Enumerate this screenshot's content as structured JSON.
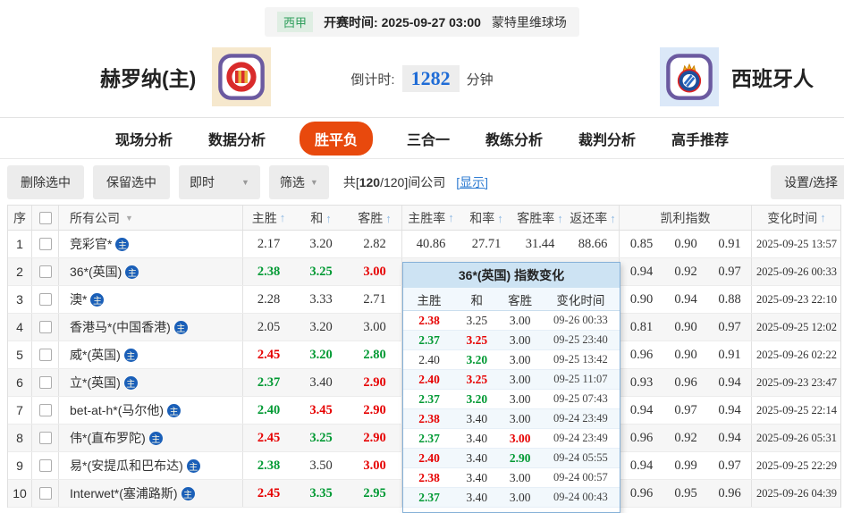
{
  "colors": {
    "up_green": "#009933",
    "down_red": "#e60000",
    "accent_red": "#e8490d",
    "countdown_blue": "#1f6cd6",
    "link_blue": "#2f7cd2"
  },
  "icons": {
    "sort_asc": "↑",
    "dropdown": "▼",
    "home_badge": "主"
  },
  "match_bar": {
    "league": "西甲",
    "kickoff_label": "开赛时间:",
    "kickoff_time": "2025-09-27 03:00",
    "venue": "蒙特里维球场"
  },
  "teams": {
    "home": "赫罗纳(主)",
    "away": "西班牙人",
    "countdown_label": "倒计时:",
    "countdown_value": "1282",
    "countdown_unit": "分钟"
  },
  "tabs": [
    {
      "id": "live-analysis",
      "label": "现场分析",
      "active": false
    },
    {
      "id": "data-analysis",
      "label": "数据分析",
      "active": false
    },
    {
      "id": "win-draw-loss",
      "label": "胜平负",
      "active": true
    },
    {
      "id": "three-in-one",
      "label": "三合一",
      "active": false
    },
    {
      "id": "coach-analysis",
      "label": "教练分析",
      "active": false
    },
    {
      "id": "referee-analysis",
      "label": "裁判分析",
      "active": false
    },
    {
      "id": "expert-picks",
      "label": "高手推荐",
      "active": false
    }
  ],
  "toolbar": {
    "delete_label": "删除选中",
    "keep_label": "保留选中",
    "instant_label": "即时",
    "filter_label": "筛选",
    "count_prefix": "共[",
    "count_bold": "120",
    "count_suffix": "/120]间公司",
    "show_link": "[显示]",
    "settings_label": "设置/选择"
  },
  "table": {
    "headers": {
      "seq": "序",
      "company": "所有公司",
      "home": "主胜",
      "draw": "和",
      "away": "客胜",
      "home_rate": "主胜率",
      "draw_rate": "和率",
      "away_rate": "客胜率",
      "return_rate": "返还率",
      "kelly": "凯利指数",
      "change_time": "变化时间"
    },
    "rows": [
      {
        "seq": "1",
        "company": "竞彩官*",
        "home": {
          "v": "2.17",
          "c": ""
        },
        "draw": {
          "v": "3.20",
          "c": ""
        },
        "away": {
          "v": "2.82",
          "c": ""
        },
        "rates": [
          "40.86",
          "27.71",
          "31.44",
          "88.66"
        ],
        "kelly": [
          "0.85",
          "0.90",
          "0.91"
        ],
        "time": "2025-09-25 13:57"
      },
      {
        "seq": "2",
        "company": "36*(英国)",
        "home": {
          "v": "2.38",
          "c": "g"
        },
        "draw": {
          "v": "3.25",
          "c": "g"
        },
        "away": {
          "v": "3.00",
          "c": "r"
        },
        "rates": [
          "",
          "",
          "",
          ""
        ],
        "kelly": [
          "0.94",
          "0.92",
          "0.97"
        ],
        "time": "2025-09-26 00:33"
      },
      {
        "seq": "3",
        "company": "澳*",
        "home": {
          "v": "2.28",
          "c": ""
        },
        "draw": {
          "v": "3.33",
          "c": ""
        },
        "away": {
          "v": "2.71",
          "c": ""
        },
        "rates": [
          "",
          "",
          "",
          ""
        ],
        "kelly": [
          "0.90",
          "0.94",
          "0.88"
        ],
        "time": "2025-09-23 22:10"
      },
      {
        "seq": "4",
        "company": "香港马*(中国香港)",
        "home": {
          "v": "2.05",
          "c": ""
        },
        "draw": {
          "v": "3.20",
          "c": ""
        },
        "away": {
          "v": "3.00",
          "c": ""
        },
        "rates": [
          "",
          "",
          "",
          ""
        ],
        "kelly": [
          "0.81",
          "0.90",
          "0.97"
        ],
        "time": "2025-09-25 12:02"
      },
      {
        "seq": "5",
        "company": "威*(英国)",
        "home": {
          "v": "2.45",
          "c": "r"
        },
        "draw": {
          "v": "3.20",
          "c": "g"
        },
        "away": {
          "v": "2.80",
          "c": "g"
        },
        "rates": [
          "",
          "",
          "",
          ""
        ],
        "kelly": [
          "0.96",
          "0.90",
          "0.91"
        ],
        "time": "2025-09-26 02:22"
      },
      {
        "seq": "6",
        "company": "立*(英国)",
        "home": {
          "v": "2.37",
          "c": "g"
        },
        "draw": {
          "v": "3.40",
          "c": ""
        },
        "away": {
          "v": "2.90",
          "c": "r"
        },
        "rates": [
          "",
          "",
          "",
          ""
        ],
        "kelly": [
          "0.93",
          "0.96",
          "0.94"
        ],
        "time": "2025-09-23 23:47"
      },
      {
        "seq": "7",
        "company": "bet-at-h*(马尔他)",
        "home": {
          "v": "2.40",
          "c": "g"
        },
        "draw": {
          "v": "3.45",
          "c": "r"
        },
        "away": {
          "v": "2.90",
          "c": "r"
        },
        "rates": [
          "",
          "",
          "",
          ""
        ],
        "kelly": [
          "0.94",
          "0.97",
          "0.94"
        ],
        "time": "2025-09-25 22:14"
      },
      {
        "seq": "8",
        "company": "伟*(直布罗陀)",
        "home": {
          "v": "2.45",
          "c": "r"
        },
        "draw": {
          "v": "3.25",
          "c": "g"
        },
        "away": {
          "v": "2.90",
          "c": "r"
        },
        "rates": [
          "",
          "",
          "",
          ""
        ],
        "kelly": [
          "0.96",
          "0.92",
          "0.94"
        ],
        "time": "2025-09-26 05:31"
      },
      {
        "seq": "9",
        "company": "易*(安提瓜和巴布达)",
        "home": {
          "v": "2.38",
          "c": "g"
        },
        "draw": {
          "v": "3.50",
          "c": ""
        },
        "away": {
          "v": "3.00",
          "c": "r"
        },
        "rates": [
          "",
          "",
          "",
          ""
        ],
        "kelly": [
          "0.94",
          "0.99",
          "0.97"
        ],
        "time": "2025-09-25 22:29"
      },
      {
        "seq": "10",
        "company": "Interwet*(塞浦路斯)",
        "home": {
          "v": "2.45",
          "c": "r"
        },
        "draw": {
          "v": "3.35",
          "c": "g"
        },
        "away": {
          "v": "2.95",
          "c": "g"
        },
        "rates": [
          "",
          "",
          "",
          ""
        ],
        "kelly": [
          "0.96",
          "0.95",
          "0.96"
        ],
        "time": "2025-09-26 04:39"
      }
    ]
  },
  "popup": {
    "title": "36*(英国) 指数变化",
    "headers": [
      "主胜",
      "和",
      "客胜",
      "变化时间"
    ],
    "rows": [
      {
        "home": {
          "v": "2.38",
          "c": "r"
        },
        "draw": {
          "v": "3.25",
          "c": ""
        },
        "away": {
          "v": "3.00",
          "c": ""
        },
        "time": "09-26 00:33"
      },
      {
        "home": {
          "v": "2.37",
          "c": "g"
        },
        "draw": {
          "v": "3.25",
          "c": "r"
        },
        "away": {
          "v": "3.00",
          "c": ""
        },
        "time": "09-25 23:40"
      },
      {
        "home": {
          "v": "2.40",
          "c": ""
        },
        "draw": {
          "v": "3.20",
          "c": "g"
        },
        "away": {
          "v": "3.00",
          "c": ""
        },
        "time": "09-25 13:42"
      },
      {
        "home": {
          "v": "2.40",
          "c": "r"
        },
        "draw": {
          "v": "3.25",
          "c": "r"
        },
        "away": {
          "v": "3.00",
          "c": ""
        },
        "time": "09-25 11:07"
      },
      {
        "home": {
          "v": "2.37",
          "c": "g"
        },
        "draw": {
          "v": "3.20",
          "c": "g"
        },
        "away": {
          "v": "3.00",
          "c": ""
        },
        "time": "09-25 07:43"
      },
      {
        "home": {
          "v": "2.38",
          "c": "r"
        },
        "draw": {
          "v": "3.40",
          "c": ""
        },
        "away": {
          "v": "3.00",
          "c": ""
        },
        "time": "09-24 23:49"
      },
      {
        "home": {
          "v": "2.37",
          "c": "g"
        },
        "draw": {
          "v": "3.40",
          "c": ""
        },
        "away": {
          "v": "3.00",
          "c": "r"
        },
        "time": "09-24 23:49"
      },
      {
        "home": {
          "v": "2.40",
          "c": "r"
        },
        "draw": {
          "v": "3.40",
          "c": ""
        },
        "away": {
          "v": "2.90",
          "c": "g"
        },
        "time": "09-24 05:55"
      },
      {
        "home": {
          "v": "2.38",
          "c": "r"
        },
        "draw": {
          "v": "3.40",
          "c": ""
        },
        "away": {
          "v": "3.00",
          "c": ""
        },
        "time": "09-24 00:57"
      },
      {
        "home": {
          "v": "2.37",
          "c": "g"
        },
        "draw": {
          "v": "3.40",
          "c": ""
        },
        "away": {
          "v": "3.00",
          "c": ""
        },
        "time": "09-24 00:43"
      }
    ]
  }
}
